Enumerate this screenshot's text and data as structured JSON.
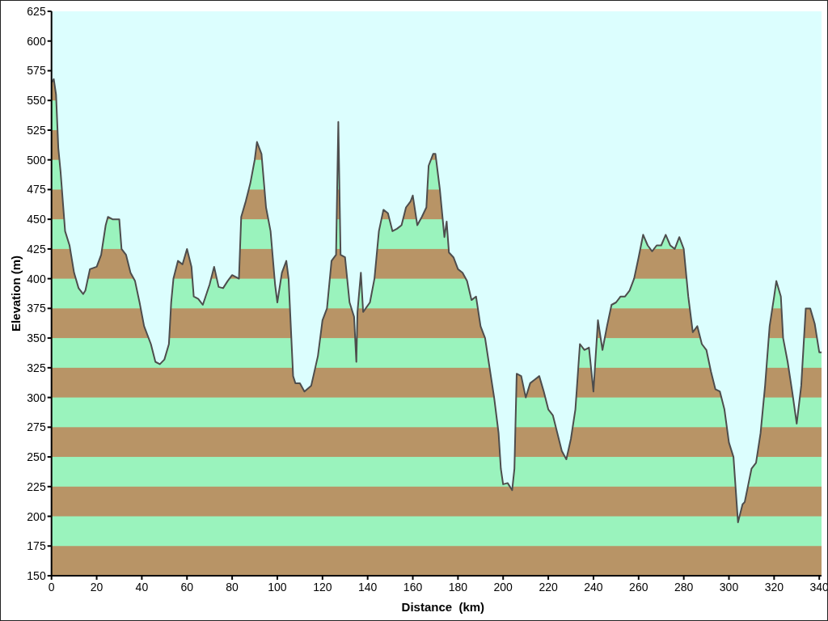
{
  "chart_data": {
    "type": "area",
    "xlabel": "Distance  (km)",
    "ylabel": "Elevation (m)",
    "x": [
      0,
      1,
      2,
      3,
      4,
      5,
      6,
      8,
      10,
      12,
      14,
      15,
      17,
      20,
      22,
      24,
      25,
      27,
      30,
      31,
      33,
      35,
      37,
      39,
      41,
      44,
      46,
      48,
      50,
      52,
      53,
      54,
      56,
      58,
      60,
      62,
      63,
      65,
      67,
      70,
      72,
      74,
      76,
      78,
      80,
      83,
      84,
      86,
      88,
      90,
      91,
      93,
      95,
      97,
      99,
      100,
      102,
      104,
      105,
      107,
      108,
      110,
      112,
      115,
      118,
      120,
      122,
      124,
      126,
      127,
      128,
      130,
      132,
      134,
      135,
      135.5,
      137,
      138,
      141,
      143,
      145,
      147,
      149,
      151,
      153,
      155,
      157,
      159,
      160,
      162,
      164,
      166,
      167,
      169,
      170,
      172,
      174,
      175,
      176,
      178,
      180,
      182,
      184,
      186,
      188,
      190,
      192,
      194,
      196,
      198,
      199,
      200,
      202,
      204,
      205,
      206,
      208,
      210,
      212,
      214,
      216,
      218,
      220,
      222,
      224,
      226,
      228,
      230,
      232,
      234,
      236,
      238,
      240,
      242,
      244,
      246,
      248,
      250,
      252,
      254,
      256,
      258,
      260,
      262,
      264,
      266,
      268,
      270,
      272,
      274,
      276,
      278,
      280,
      282,
      284,
      286,
      288,
      290,
      292,
      294,
      296,
      298,
      300,
      302,
      304,
      306,
      307,
      310,
      312,
      314,
      316,
      318,
      320,
      321,
      323,
      324,
      326,
      328,
      330,
      332,
      334,
      336,
      338,
      340,
      341
    ],
    "series": [
      {
        "color": "#4d4d4d",
        "values": [
          565,
          568,
          555,
          510,
          490,
          465,
          440,
          428,
          405,
          392,
          387,
          390,
          408,
          410,
          420,
          445,
          452,
          450,
          450,
          425,
          420,
          405,
          398,
          380,
          360,
          345,
          330,
          328,
          332,
          345,
          380,
          400,
          415,
          412,
          425,
          410,
          385,
          383,
          378,
          395,
          410,
          393,
          392,
          398,
          403,
          400,
          452,
          465,
          480,
          500,
          515,
          505,
          460,
          440,
          395,
          380,
          405,
          415,
          400,
          318,
          312,
          312,
          305,
          310,
          335,
          365,
          375,
          415,
          420,
          532,
          420,
          418,
          380,
          368,
          330,
          372,
          405,
          372,
          380,
          400,
          440,
          458,
          455,
          440,
          442,
          445,
          460,
          465,
          470,
          445,
          452,
          460,
          495,
          505,
          505,
          475,
          435,
          448,
          422,
          418,
          408,
          405,
          398,
          382,
          385,
          360,
          350,
          325,
          300,
          270,
          240,
          227,
          228,
          222,
          240,
          320,
          318,
          300,
          312,
          315,
          318,
          305,
          290,
          285,
          270,
          255,
          248,
          265,
          290,
          345,
          340,
          342,
          305,
          365,
          340,
          360,
          378,
          380,
          385,
          385,
          390,
          400,
          418,
          437,
          428,
          423,
          428,
          428,
          437,
          428,
          425,
          435,
          425,
          385,
          355,
          360,
          345,
          340,
          322,
          307,
          305,
          290,
          262,
          250,
          195,
          210,
          212,
          240,
          245,
          270,
          310,
          360,
          385,
          398,
          385,
          350,
          330,
          305,
          278,
          310,
          375,
          375,
          362,
          338,
          338
        ]
      }
    ],
    "xlim": [
      0,
      341
    ],
    "ylim": [
      150,
      625
    ],
    "xticks": [
      0,
      20,
      40,
      60,
      80,
      100,
      120,
      140,
      160,
      180,
      200,
      220,
      240,
      260,
      280,
      300,
      320,
      340
    ],
    "yticks": [
      150,
      175,
      200,
      225,
      250,
      275,
      300,
      325,
      350,
      375,
      400,
      425,
      450,
      475,
      500,
      525,
      550,
      575,
      600,
      625
    ]
  }
}
